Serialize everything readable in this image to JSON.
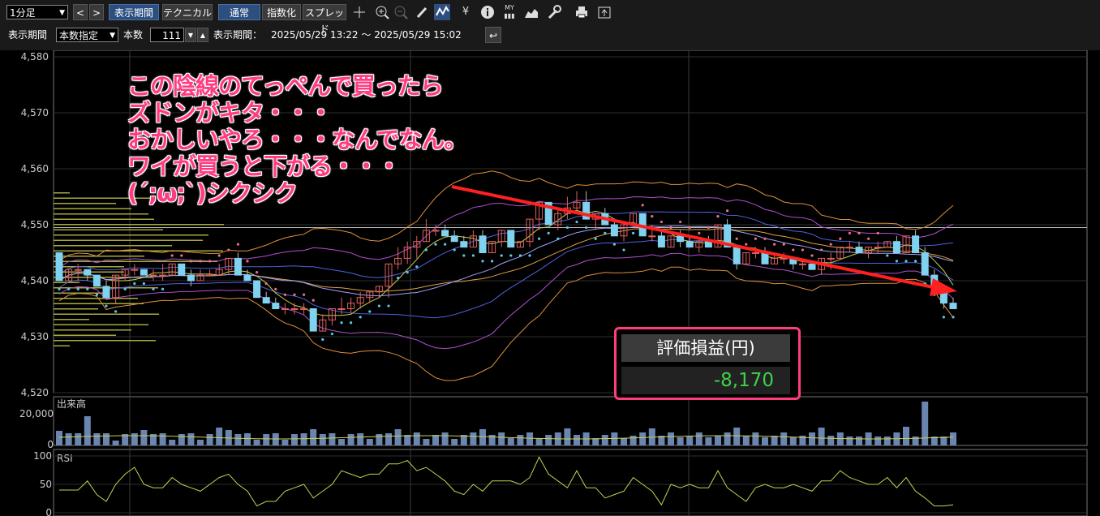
{
  "toolbar": {
    "timeframe": "1分足",
    "nav_prev": "<",
    "nav_next": ">",
    "display_period_btn": "表示期間",
    "technical_btn": "テクニカル",
    "normal_btn": "通常",
    "index_btn": "指数化",
    "spread_btn": "スプレッド",
    "yen_icon": "¥",
    "info_icon": "i",
    "my_icon": "MY"
  },
  "period_bar": {
    "label": "表示期間",
    "mode": "本数指定",
    "count_label": "本数",
    "count": "111",
    "range_label": "表示期間：",
    "range": "2025/05/29 13:22 ～ 2025/05/29 15:02"
  },
  "callout": {
    "lines": [
      "この陰線のてっぺんで買ったら",
      "ズドンがキタ・・・",
      "おかしいやろ・・・なんでなん。",
      "ワイが買うと下がる・・・",
      "(´;ω;`)シクシク"
    ]
  },
  "pl": {
    "title": "評価損益(円)",
    "value": "-8,170"
  },
  "price_axis": [
    "4,580",
    "4,570",
    "4,560",
    "4,550",
    "4,540",
    "4,530",
    "4,520"
  ],
  "volume_label": "出来高",
  "volume_axis": [
    "20,000",
    "0"
  ],
  "rsi_label": "RSI",
  "rsi_axis": [
    "100",
    "50",
    "0"
  ],
  "colors": {
    "up": "#e06060",
    "down": "#7fd3f0",
    "annotation": "#ff3c82",
    "profit_loss": "#3ed04a"
  },
  "chart_data": {
    "type": "candlestick",
    "title": "",
    "ylim": [
      4520,
      4580
    ],
    "candles": [
      [
        4545,
        4545,
        4540,
        4540
      ],
      [
        4540,
        4542,
        4540,
        4542
      ],
      [
        4542,
        4543,
        4540,
        4542
      ],
      [
        4542,
        4542,
        4540,
        4541
      ],
      [
        4541,
        4541,
        4539,
        4539
      ],
      [
        4539,
        4540,
        4537,
        4537
      ],
      [
        4537,
        4541,
        4536,
        4541
      ],
      [
        4541,
        4542,
        4540,
        4542
      ],
      [
        4542,
        4543,
        4541,
        4542
      ],
      [
        4542,
        4542,
        4541,
        4541
      ],
      [
        4541,
        4542,
        4540,
        4541
      ],
      [
        4541,
        4543,
        4540,
        4541
      ],
      [
        4541,
        4543,
        4541,
        4543
      ],
      [
        4543,
        4543,
        4541,
        4541
      ],
      [
        4541,
        4542,
        4539,
        4540
      ],
      [
        4540,
        4542,
        4540,
        4541
      ],
      [
        4541,
        4542,
        4541,
        4541
      ],
      [
        4541,
        4543,
        4541,
        4542
      ],
      [
        4542,
        4544,
        4541,
        4544
      ],
      [
        4544,
        4545,
        4541,
        4541
      ],
      [
        4541,
        4542,
        4540,
        4540
      ],
      [
        4540,
        4540,
        4537,
        4537
      ],
      [
        4537,
        4538,
        4536,
        4536
      ],
      [
        4536,
        4537,
        4535,
        4535
      ],
      [
        4535,
        4536,
        4534,
        4535
      ],
      [
        4535,
        4536,
        4534,
        4535
      ],
      [
        4535,
        4536,
        4534,
        4535
      ],
      [
        4535,
        4535,
        4531,
        4531
      ],
      [
        4531,
        4534,
        4531,
        4533
      ],
      [
        4533,
        4535,
        4532,
        4535
      ],
      [
        4535,
        4537,
        4534,
        4535
      ],
      [
        4535,
        4537,
        4534,
        4536
      ],
      [
        4536,
        4538,
        4535,
        4537
      ],
      [
        4537,
        4538,
        4536,
        4538
      ],
      [
        4538,
        4539,
        4537,
        4539
      ],
      [
        4539,
        4543,
        4537,
        4543
      ],
      [
        4543,
        4546,
        4542,
        4544
      ],
      [
        4544,
        4547,
        4543,
        4546
      ],
      [
        4546,
        4548,
        4544,
        4547
      ],
      [
        4547,
        4551,
        4547,
        4549
      ],
      [
        4549,
        4550,
        4548,
        4549
      ],
      [
        4549,
        4550,
        4548,
        4548
      ],
      [
        4548,
        4549,
        4547,
        4547
      ],
      [
        4547,
        4548,
        4546,
        4546
      ],
      [
        4546,
        4549,
        4546,
        4548
      ],
      [
        4548,
        4549,
        4545,
        4545
      ],
      [
        4545,
        4547,
        4545,
        4547
      ],
      [
        4547,
        4549,
        4546,
        4549
      ],
      [
        4549,
        4549,
        4546,
        4546
      ],
      [
        4546,
        4547,
        4546,
        4547
      ],
      [
        4547,
        4551,
        4546,
        4551
      ],
      [
        4551,
        4554,
        4549,
        4554
      ],
      [
        4554,
        4554,
        4550,
        4550
      ],
      [
        4550,
        4553,
        4549,
        4552
      ],
      [
        4552,
        4555,
        4551,
        4553
      ],
      [
        4553,
        4556,
        4552,
        4554
      ],
      [
        4554,
        4556,
        4551,
        4551
      ],
      [
        4551,
        4552,
        4549,
        4552
      ],
      [
        4552,
        4553,
        4550,
        4550
      ],
      [
        4550,
        4551,
        4548,
        4548
      ],
      [
        4548,
        4550,
        4547,
        4550
      ],
      [
        4550,
        4552,
        4550,
        4552
      ],
      [
        4552,
        4552,
        4548,
        4548
      ],
      [
        4548,
        4550,
        4547,
        4548
      ],
      [
        4548,
        4549,
        4546,
        4546
      ],
      [
        4546,
        4548,
        4546,
        4548
      ],
      [
        4548,
        4549,
        4546,
        4547
      ],
      [
        4547,
        4548,
        4546,
        4546
      ],
      [
        4546,
        4547,
        4545,
        4547
      ],
      [
        4547,
        4548,
        4546,
        4546
      ],
      [
        4546,
        4550,
        4546,
        4550
      ],
      [
        4550,
        4551,
        4546,
        4546
      ],
      [
        4546,
        4546,
        4542,
        4543
      ],
      [
        4543,
        4545,
        4543,
        4545
      ],
      [
        4545,
        4546,
        4544,
        4545
      ],
      [
        4545,
        4546,
        4543,
        4543
      ],
      [
        4543,
        4545,
        4543,
        4544
      ],
      [
        4544,
        4545,
        4543,
        4544
      ],
      [
        4544,
        4544,
        4542,
        4543
      ],
      [
        4543,
        4544,
        4542,
        4543
      ],
      [
        4543,
        4543,
        4542,
        4542
      ],
      [
        4542,
        4544,
        4541,
        4544
      ],
      [
        4544,
        4545,
        4542,
        4544
      ],
      [
        4544,
        4546,
        4544,
        4546
      ],
      [
        4546,
        4547,
        4545,
        4546
      ],
      [
        4546,
        4547,
        4545,
        4545
      ],
      [
        4545,
        4546,
        4544,
        4546
      ],
      [
        4546,
        4547,
        4545,
        4546
      ],
      [
        4546,
        4547,
        4546,
        4547
      ],
      [
        4547,
        4548,
        4545,
        4545
      ],
      [
        4545,
        4548,
        4545,
        4548
      ],
      [
        4548,
        4549,
        4545,
        4545
      ],
      [
        4545,
        4546,
        4541,
        4541
      ],
      [
        4541,
        4542,
        4539,
        4539
      ],
      [
        4539,
        4539,
        4535,
        4536
      ],
      [
        4536,
        4537,
        4535,
        4535
      ]
    ]
  }
}
